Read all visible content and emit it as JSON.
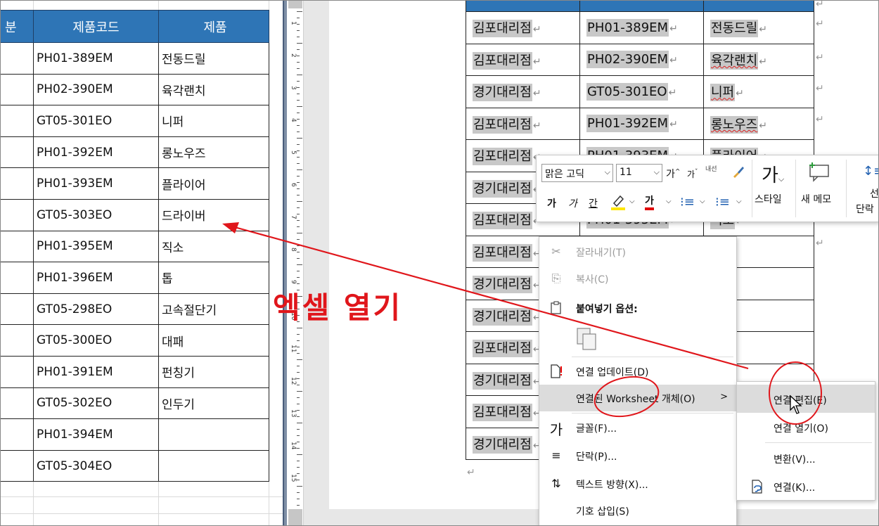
{
  "excel": {
    "headers": [
      "분",
      "제품코드",
      "제품"
    ],
    "rows": [
      {
        "code": "PH01-389EM",
        "product": "전동드릴"
      },
      {
        "code": "PH02-390EM",
        "product": "육각랜치"
      },
      {
        "code": "GT05-301EO",
        "product": "니퍼"
      },
      {
        "code": "PH01-392EM",
        "product": "롱노우즈"
      },
      {
        "code": "PH01-393EM",
        "product": "플라이어"
      },
      {
        "code": "GT05-303EO",
        "product": "드라이버"
      },
      {
        "code": "PH01-395EM",
        "product": "직소"
      },
      {
        "code": "PH01-396EM",
        "product": "톱"
      },
      {
        "code": "GT05-298EO",
        "product": "고속절단기"
      },
      {
        "code": "GT05-300EO",
        "product": "대패"
      },
      {
        "code": "PH01-391EM",
        "product": "펀칭기"
      },
      {
        "code": "GT05-302EO",
        "product": "인두기"
      },
      {
        "code": "PH01-394EM",
        "product": ""
      },
      {
        "code": "GT05-304EO",
        "product": ""
      }
    ]
  },
  "word": {
    "ruler_labels": [
      "1",
      "2",
      "3",
      "4",
      "5",
      "6",
      "7",
      "8",
      "9",
      "10",
      "11",
      "12",
      "13",
      "14",
      "15"
    ],
    "rows": [
      {
        "branch": "김포대리점",
        "code": "PH01-389EM",
        "product": "전동드릴"
      },
      {
        "branch": "김포대리점",
        "code": "PH02-390EM",
        "product": "육각랜치"
      },
      {
        "branch": "경기대리점",
        "code": "GT05-301EO",
        "product": "니퍼"
      },
      {
        "branch": "김포대리점",
        "code": "PH01-392EM",
        "product": "롱노우즈"
      },
      {
        "branch": "김포대리점",
        "code": "PH01-393EM",
        "product": "플라이어"
      },
      {
        "branch": "경기대리점",
        "code": "",
        "product": ""
      },
      {
        "branch": "김포대리점",
        "code": "PH01-395EM",
        "product": "직소"
      },
      {
        "branch": "김포대리점",
        "code": "",
        "product": ""
      },
      {
        "branch": "경기대리점",
        "code": "",
        "product": ""
      },
      {
        "branch": "경기대리점",
        "code": "",
        "product": ""
      },
      {
        "branch": "김포대리점",
        "code": "",
        "product": ""
      },
      {
        "branch": "경기대리점",
        "code": "",
        "product": ""
      },
      {
        "branch": "김포대리점",
        "code": "",
        "product": ""
      },
      {
        "branch": "경기대리점",
        "code": "",
        "product": ""
      }
    ],
    "para_mark": "↵"
  },
  "minibar": {
    "font_name": "맑은 고딕",
    "font_size": "11",
    "grow_font": "가",
    "shrink_font": "가",
    "phonetic": "내선",
    "bold": "가",
    "italic": "가",
    "underline": "간",
    "font_color_glyph": "가",
    "styles_label": "스타일",
    "new_memo_label": "새 메모",
    "line_spacing_label": "선",
    "paragraph_label": "단락",
    "accent_highlight": "#ffe600",
    "accent_font_color": "#e00000"
  },
  "context_menu": {
    "items": [
      {
        "label": "잘라내기(T)",
        "icon": "cut-icon",
        "glyph": "✂",
        "enabled": false
      },
      {
        "label": "복사(C)",
        "icon": "copy-icon",
        "glyph": "⎘",
        "enabled": false
      },
      {
        "label": "붙여넣기 옵션:",
        "icon": "paste-icon",
        "glyph": "📋",
        "enabled": true
      },
      {
        "label": "연결 업데이트(D)",
        "icon": "update-link-icon",
        "glyph": "🗋",
        "enabled": true
      },
      {
        "label": "연결된 Worksheet 개체(O)",
        "icon": "",
        "glyph": "",
        "enabled": true
      },
      {
        "label": "글꼴(F)...",
        "icon": "font-icon",
        "glyph": "가",
        "enabled": true
      },
      {
        "label": "단락(P)...",
        "icon": "paragraph-icon",
        "glyph": "≡",
        "enabled": true
      },
      {
        "label": "텍스트 방향(X)...",
        "icon": "text-direction-icon",
        "glyph": "⇅",
        "enabled": true
      },
      {
        "label": "기호 삽입(S)",
        "icon": "",
        "glyph": "",
        "enabled": true
      }
    ],
    "submenu_arrow": ">"
  },
  "submenu": {
    "items": [
      {
        "label": "연결 편집(E)"
      },
      {
        "label": "연결 열기(O)"
      },
      {
        "label": "변환(V)..."
      },
      {
        "label": "연결(K)..."
      }
    ]
  },
  "annotation": {
    "text": "엑셀 열기",
    "color": "#e0161b"
  }
}
